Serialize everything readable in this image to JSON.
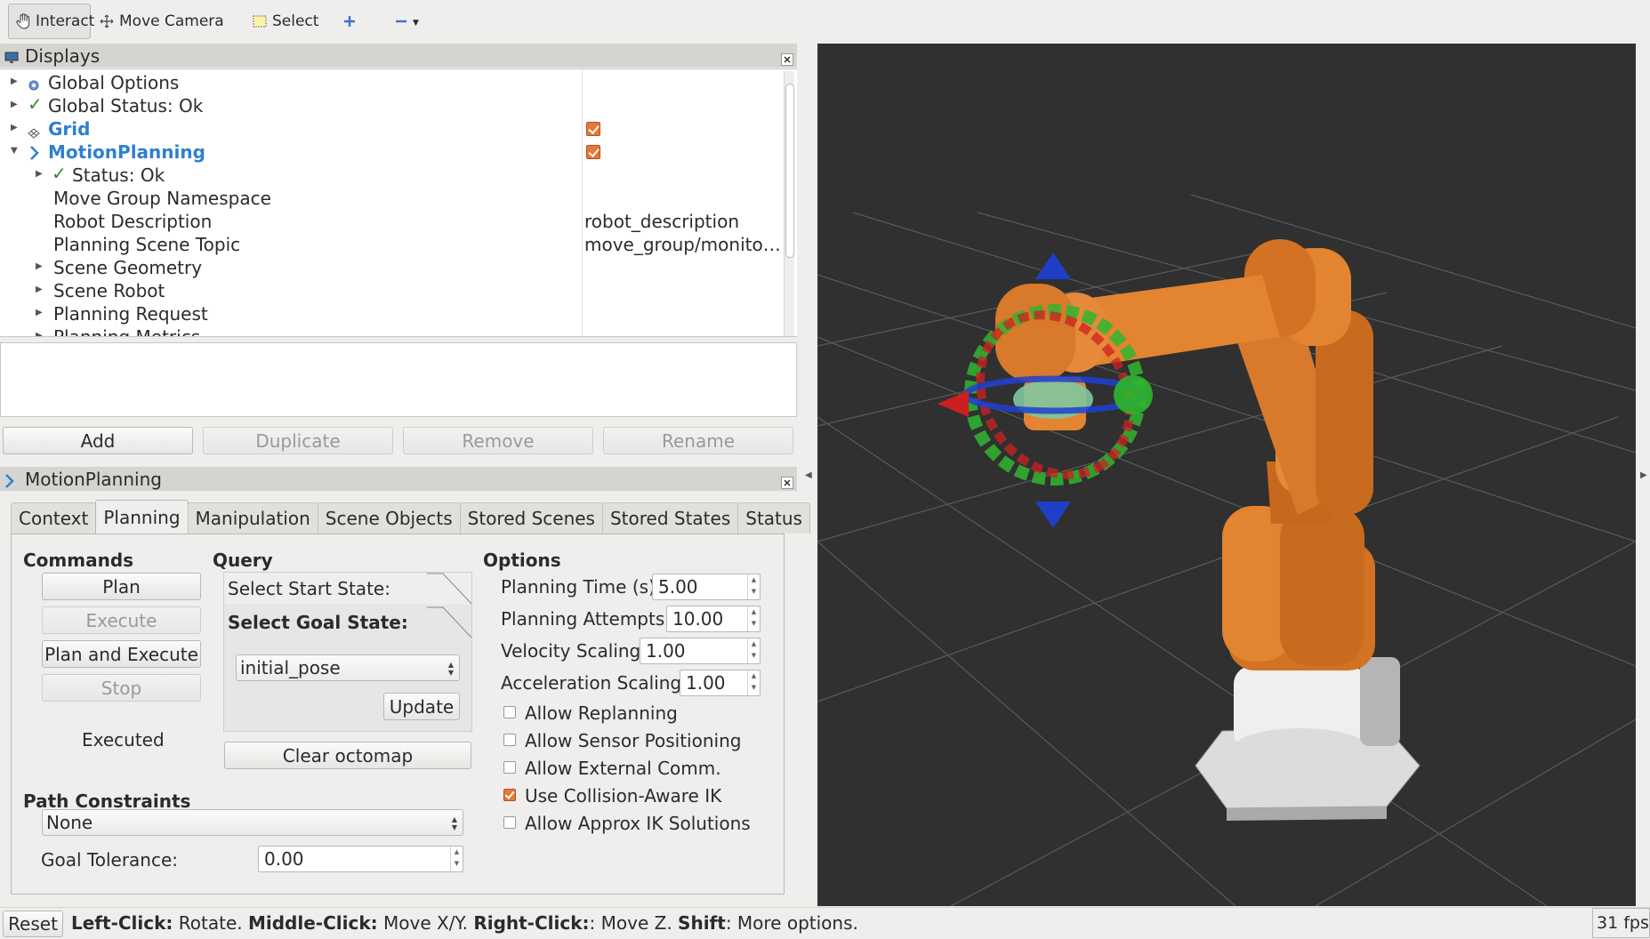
{
  "toolbar": {
    "interact": "Interact",
    "move_camera": "Move Camera",
    "select": "Select"
  },
  "displays_panel": {
    "title": "Displays",
    "rows": [
      {
        "label": "Global Options",
        "value": ""
      },
      {
        "label": "Global Status: Ok",
        "value": ""
      },
      {
        "label": "Grid",
        "value": ""
      },
      {
        "label": "MotionPlanning",
        "value": ""
      },
      {
        "label": "Status: Ok",
        "value": ""
      },
      {
        "label": "Move Group Namespace",
        "value": ""
      },
      {
        "label": "Robot Description",
        "value": "robot_description"
      },
      {
        "label": "Planning Scene Topic",
        "value": "move_group/monito…"
      },
      {
        "label": "Scene Geometry",
        "value": ""
      },
      {
        "label": "Scene Robot",
        "value": ""
      },
      {
        "label": "Planning Request",
        "value": ""
      },
      {
        "label": "Planning Metrics",
        "value": ""
      }
    ],
    "buttons": {
      "add": "Add",
      "duplicate": "Duplicate",
      "remove": "Remove",
      "rename": "Rename"
    }
  },
  "motion_panel": {
    "title": "MotionPlanning",
    "tabs": [
      "Context",
      "Planning",
      "Manipulation",
      "Scene Objects",
      "Stored Scenes",
      "Stored States",
      "Status"
    ],
    "commands": {
      "title": "Commands",
      "plan": "Plan",
      "execute": "Execute",
      "plan_and_execute": "Plan and Execute",
      "stop": "Stop",
      "status": "Executed"
    },
    "query": {
      "title": "Query",
      "start_state": "Select Start State:",
      "goal_state": "Select Goal State:",
      "goal_value": "initial_pose",
      "update": "Update",
      "clear_octomap": "Clear octomap"
    },
    "options": {
      "title": "Options",
      "planning_time_label": "Planning Time (s):",
      "planning_time": "5.00",
      "planning_attempts_label": "Planning Attempts:",
      "planning_attempts": "10.00",
      "velocity_scaling_label": "Velocity Scaling:",
      "velocity_scaling": "1.00",
      "acceleration_scaling_label": "Acceleration Scaling:",
      "acceleration_scaling": "1.00",
      "checkboxes": [
        {
          "label": "Allow Replanning",
          "checked": false
        },
        {
          "label": "Allow Sensor Positioning",
          "checked": false
        },
        {
          "label": "Allow External Comm.",
          "checked": false
        },
        {
          "label": "Use Collision-Aware IK",
          "checked": true
        },
        {
          "label": "Allow Approx IK Solutions",
          "checked": false
        }
      ]
    },
    "path_constraints": {
      "title": "Path Constraints",
      "value": "None",
      "goal_tolerance_label": "Goal Tolerance:",
      "goal_tolerance": "0.00"
    }
  },
  "statusbar": {
    "reset": "Reset",
    "k1": "Left-Click:",
    "t1": " Rotate. ",
    "k2": "Middle-Click:",
    "t2": " Move X/Y. ",
    "k3": "Right-Click:",
    "t3": ": Move Z. ",
    "k4": "Shift",
    "t4": ": More options.",
    "fps": "31 fps"
  },
  "colors": {
    "accent_orange": "#e8773a",
    "link_blue": "#2f7fd1",
    "viewport_bg": "#303030",
    "robot_orange": "#e07a1f"
  }
}
